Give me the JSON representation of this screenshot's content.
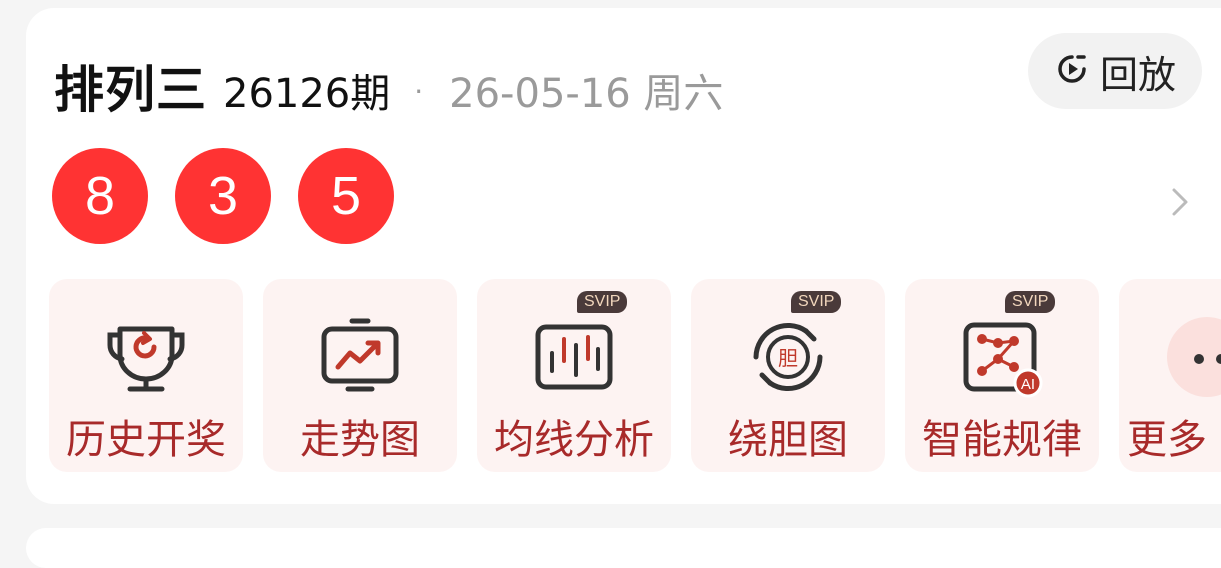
{
  "header": {
    "lottery_name": "排列三",
    "issue": "26126期",
    "separator": "·",
    "date": "26-05-16 周六",
    "replay_label": "回放"
  },
  "balls": [
    "8",
    "3",
    "5"
  ],
  "tiles": [
    {
      "label": "历史开奖",
      "icon": "trophy-icon",
      "badge": ""
    },
    {
      "label": "走势图",
      "icon": "trend-monitor-icon",
      "badge": ""
    },
    {
      "label": "均线分析",
      "icon": "candlestick-chart-icon",
      "badge": "SVIP"
    },
    {
      "label": "绕胆图",
      "icon": "circular-dan-icon",
      "badge": "SVIP"
    },
    {
      "label": "智能规律",
      "icon": "ai-network-icon",
      "badge": "SVIP"
    },
    {
      "label": "更多",
      "icon": "more-dots-icon",
      "badge": ""
    }
  ],
  "colors": {
    "ball": "#ff3333",
    "tile_bg": "#fdf3f2",
    "tile_text": "#a82a2a",
    "icon_dark": "#333333",
    "icon_red": "#c0392b"
  }
}
